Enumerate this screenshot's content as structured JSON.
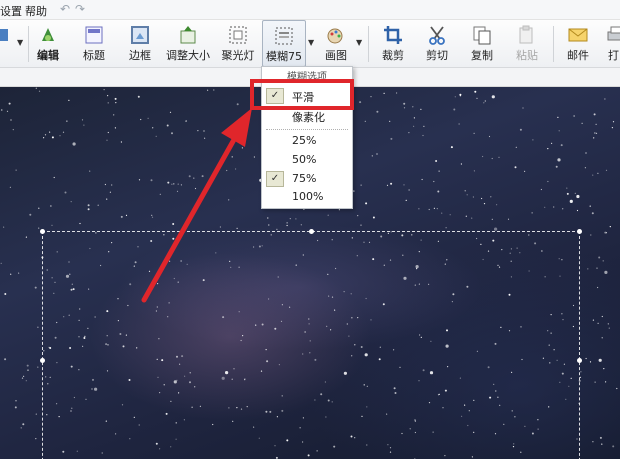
{
  "menubar": {
    "items": [
      "设置",
      "帮助"
    ],
    "undo_icon": "undo-icon",
    "redo_icon": "redo-icon"
  },
  "toolbar": {
    "tools": [
      {
        "label": "编辑",
        "icon": "edit-icon",
        "disabled": false
      },
      {
        "label": "标题",
        "icon": "title-icon",
        "disabled": false
      },
      {
        "label": "边框",
        "icon": "border-icon",
        "disabled": false
      },
      {
        "label": "调整大小",
        "icon": "resize-icon",
        "disabled": false
      },
      {
        "label": "聚光灯",
        "icon": "spotlight-icon",
        "disabled": false
      },
      {
        "label": "模糊75",
        "icon": "blur-icon",
        "disabled": false,
        "active": true
      },
      {
        "label": "画图",
        "icon": "draw-icon",
        "disabled": false
      },
      {
        "label": "裁剪",
        "icon": "crop-icon",
        "disabled": false
      },
      {
        "label": "剪切",
        "icon": "cut-icon",
        "disabled": false
      },
      {
        "label": "复制",
        "icon": "copy-icon",
        "disabled": false
      },
      {
        "label": "粘贴",
        "icon": "paste-icon",
        "disabled": true
      },
      {
        "label": "邮件",
        "icon": "mail-icon",
        "disabled": false
      },
      {
        "label": "打",
        "icon": "print-icon",
        "disabled": false
      }
    ]
  },
  "blur_menu": {
    "header": "模糊选项",
    "items": [
      {
        "label": "平滑",
        "checked": true
      },
      {
        "label": "像素化",
        "checked": false
      },
      {
        "label": "25%",
        "checked": false
      },
      {
        "label": "50%",
        "checked": false
      },
      {
        "label": "75%",
        "checked": true
      },
      {
        "label": "100%",
        "checked": false
      }
    ],
    "check_glyph": "✓"
  },
  "colors": {
    "highlight": "#e0262b",
    "arrow": "#e0262b"
  }
}
